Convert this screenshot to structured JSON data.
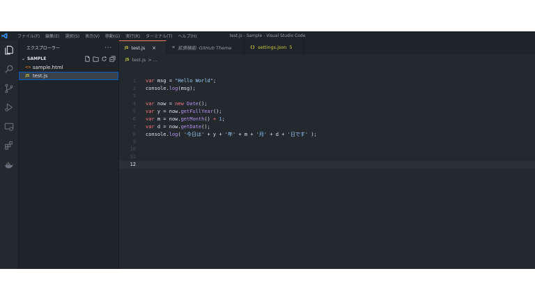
{
  "window_title": "test.js - Sample - Visual Studio Code",
  "menu": [
    "ファイル(F)",
    "編集(E)",
    "選択(S)",
    "表示(V)",
    "移動(G)",
    "実行(R)",
    "ターミナル(T)",
    "ヘルプ(H)"
  ],
  "sidebar": {
    "title": "エクスプローラー",
    "more": "···",
    "folder": "SAMPLE",
    "files": [
      {
        "icon": "<>",
        "name": "sample.html",
        "icon_color": "#e37933"
      },
      {
        "icon": "JS",
        "name": "test.js",
        "icon_color": "#cbcb41"
      }
    ]
  },
  "tabs": [
    {
      "icon": "JS",
      "label": "test.js",
      "close": "×"
    },
    {
      "icon": "≡",
      "label": "拡張機能: GitHub Theme"
    },
    {
      "icon": "{}",
      "label": "settings.json",
      "badge": "5"
    }
  ],
  "breadcrumb": {
    "icon": "JS",
    "file": "test.js",
    "rest": "> ..."
  },
  "code_lines": [
    {
      "n": "1"
    },
    {
      "n": "2"
    },
    {
      "n": "3"
    },
    {
      "n": "4"
    },
    {
      "n": "5"
    },
    {
      "n": "6"
    },
    {
      "n": "7"
    },
    {
      "n": "8"
    },
    {
      "n": "9"
    },
    {
      "n": "10"
    },
    {
      "n": "11"
    },
    {
      "n": "12"
    }
  ],
  "code": {
    "l1": {
      "kw": "var",
      "name": " msg = ",
      "str": "\"Hello World\"",
      "end": ";"
    },
    "l2": {
      "obj": "console.",
      "fn": "log",
      "rest": "(msg);"
    },
    "l4": {
      "kw": "var",
      "name": " now = ",
      "new": "new",
      "fn": " Date",
      "end": "();"
    },
    "l5": {
      "kw": "var",
      "name": " y = now.",
      "fn": "getFullYear",
      "end": "();"
    },
    "l6": {
      "kw": "var",
      "name": " m = now.",
      "fn": "getMonth",
      "mid": "() ",
      "op": "+",
      "num": " 1",
      "end": ";"
    },
    "l7": {
      "kw": "var",
      "name": " d = now.",
      "fn": "getDate",
      "end": "();"
    },
    "l8": {
      "obj": "console.",
      "fn": "log",
      "a": "( ",
      "s1": "'今日は'",
      "p1": " + y + ",
      "s2": "'年'",
      "p2": " + m + ",
      "s3": "'月'",
      "p3": " + d + ",
      "s4": "'日です'",
      "end": " );"
    }
  },
  "colors": {
    "accent": "#f9826c",
    "editor_bg": "#24292e",
    "sidebar_bg": "#1f2428",
    "selection": "#005cc5"
  }
}
